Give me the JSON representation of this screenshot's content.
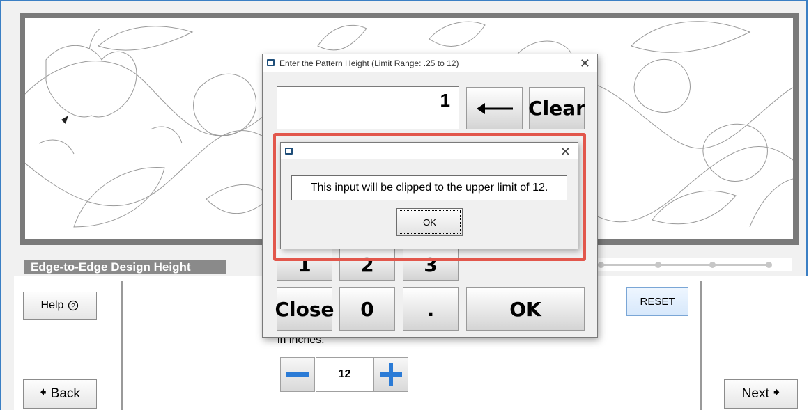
{
  "main": {
    "section_label": "Edge-to-Edge Design Height",
    "help_label": "Help",
    "help_icon": "question-circle-icon",
    "back_label": "Back",
    "next_label": "Next",
    "reset_label": "RESET",
    "units_text": "in inches.",
    "height_value": "12"
  },
  "keypad_dialog": {
    "title": "Enter the Pattern Height   (Limit Range: .25 to 12)",
    "display_value": "1",
    "backspace_icon": "left-arrow-icon",
    "keys": {
      "clear": "Clear",
      "one": "1",
      "two": "2",
      "three": "3",
      "close": "Close",
      "zero": "0",
      "dot": ".",
      "ok": "OK"
    }
  },
  "alert_dialog": {
    "message": "This input will be clipped to the upper limit of 12.",
    "ok_label": "OK"
  },
  "colors": {
    "frame_border": "#3b7fc4",
    "highlight": "#e2574c",
    "stepper_icon": "#2b7bd6"
  }
}
